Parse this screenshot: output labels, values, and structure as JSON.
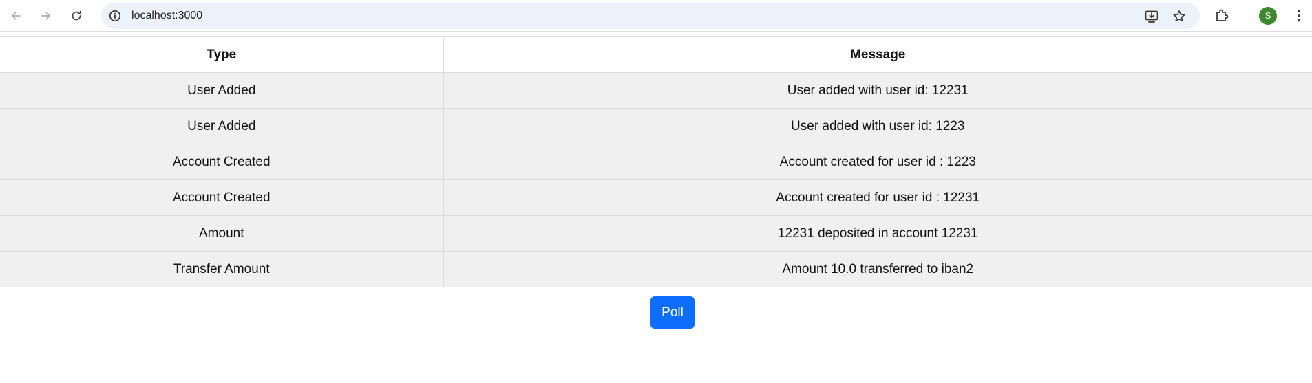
{
  "browser": {
    "url": "localhost:3000",
    "profile_initial": "S",
    "icons": {
      "back": "arrow-left-icon",
      "forward": "arrow-right-icon",
      "reload": "reload-icon",
      "site_info": "info-icon",
      "install": "install-app-icon",
      "bookmark": "star-icon",
      "extensions": "puzzle-icon",
      "menu": "kebab-menu-icon"
    },
    "avatar_color": "#3d8a2e"
  },
  "table": {
    "headers": [
      "Type",
      "Message"
    ],
    "rows": [
      [
        "User Added",
        "User added with user id: 12231"
      ],
      [
        "User Added",
        "User added with user id: 1223"
      ],
      [
        "Account Created",
        "Account created for user id : 1223"
      ],
      [
        "Account Created",
        "Account created for user id : 12231"
      ],
      [
        "Amount",
        "12231 deposited in account 12231"
      ],
      [
        "Transfer Amount",
        "Amount 10.0 transferred to iban2"
      ]
    ],
    "row_bg": "#f0f0f0"
  },
  "poll_button": {
    "label": "Poll",
    "color": "#0d6efd"
  }
}
